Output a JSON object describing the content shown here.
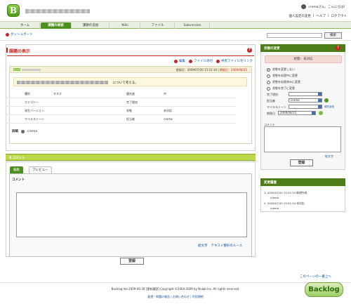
{
  "header": {
    "user": "cremaさん、こんにちは！",
    "links": [
      "個人設定の変更",
      "ヘルプ",
      "ログアウト"
    ]
  },
  "tabs": [
    "ホーム",
    "課題の検索",
    "課題の追加",
    "Wiki",
    "ファイル",
    "Subversion"
  ],
  "subbar": {
    "dashboard": "ダッシュボード",
    "search_button": "検索"
  },
  "main": {
    "title": "課題の表示",
    "actions": [
      "編集",
      "ファイル添付",
      "共有ファイルをリンク"
    ],
    "registered": "登録日：2009/07/20 15:51:34",
    "due": "期限日：2009/08/15",
    "summary": "について考える。",
    "fields": [
      "種別",
      "タスク",
      "優先度",
      "中",
      "カテゴリー",
      "",
      "完了理由",
      "",
      "発生バージョン",
      "",
      "状態",
      "未対応",
      "マイルストーン",
      "",
      "担当者",
      "crema"
    ],
    "detail_label": "詳細",
    "detail_user": "crema"
  },
  "comments": {
    "header": "0 コメント",
    "tabs": [
      "編集",
      "プレビュー"
    ],
    "label": "コメント",
    "links": [
      "絵文字",
      "テキスト整形のルール"
    ],
    "button": "登録",
    "top": "このページの一番上へ"
  },
  "sidebar": {
    "title": "状態の変更",
    "status": "状態：未対応",
    "radios": [
      "状態を変更しない",
      "状態を処理中に変更",
      "状態を処理済みに変更",
      "状態を完了に変更"
    ],
    "labels": [
      "完了理由",
      "担当者",
      "マイルストーン",
      "期限日"
    ],
    "values": [
      "",
      "crema",
      "",
      "2009/08/15"
    ],
    "small": "現在返信",
    "comment": "コメント",
    "emoji": "絵文字",
    "button": "登録"
  },
  "history": {
    "title": "変更履歴",
    "items": [
      {
        "n": "1.",
        "time": "2009/07/20 15:51:34",
        "state": "新規作成",
        "user": "crema"
      },
      {
        "n": "2.",
        "time": "2009/07/20 15:51:34",
        "state": "未対応",
        "user": "crema"
      }
    ]
  },
  "footer": {
    "line": "Backlog Ver.2009-06-30 [更新履歴] Copyright ©2004-2009 by Nulab Inc. All rights reserved.",
    "line2": "要望・問題の報告 | お問い合わせ | 利用規約",
    "logo": "Backlog"
  }
}
